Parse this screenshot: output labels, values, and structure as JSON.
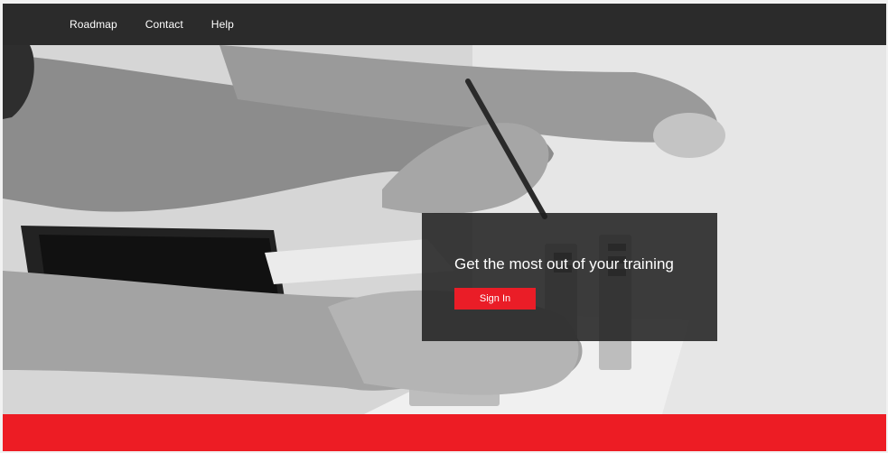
{
  "nav": {
    "items": [
      {
        "label": "Roadmap"
      },
      {
        "label": "Contact"
      },
      {
        "label": "Help"
      }
    ]
  },
  "hero": {
    "title": "Get the most out of your training",
    "signin_label": "Sign In",
    "image_icon": "office-hands-keyboard-photo"
  },
  "colors": {
    "topbar": "#2b2b2b",
    "accent": "#ea1d27",
    "band": "#ed1c24"
  }
}
